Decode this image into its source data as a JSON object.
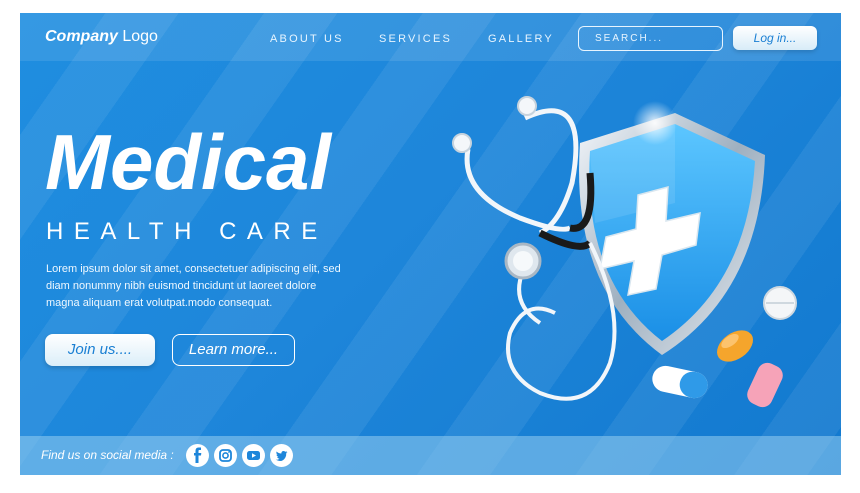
{
  "header": {
    "logo_bold": "Company",
    "logo_rest": " Logo",
    "nav": [
      "ABOUT US",
      "SERVICES",
      "GALLERY"
    ],
    "search_placeholder": "SEARCH...",
    "login_label": "Log in..."
  },
  "hero": {
    "title": "Medical",
    "subtitle": "HEALTH CARE",
    "description": [
      "Lorem ipsum dolor sit amet, consectetuer adipiscing elit, sed",
      "diam nonummy nibh euismod tincidunt ut laoreet dolore",
      "magna aliquam erat volutpat.modo consequat."
    ],
    "join_label": "Join us....",
    "learn_label": "Learn more..."
  },
  "footer": {
    "social_text": "Find us on social media :",
    "social_icons": [
      "facebook-icon",
      "instagram-icon",
      "youtube-icon",
      "twitter-icon"
    ]
  },
  "colors": {
    "background": "#1e86da",
    "accent": "#1a7fd3",
    "text": "#ffffff"
  },
  "illustration": [
    "stethoscope",
    "shield-with-cross",
    "pills"
  ]
}
